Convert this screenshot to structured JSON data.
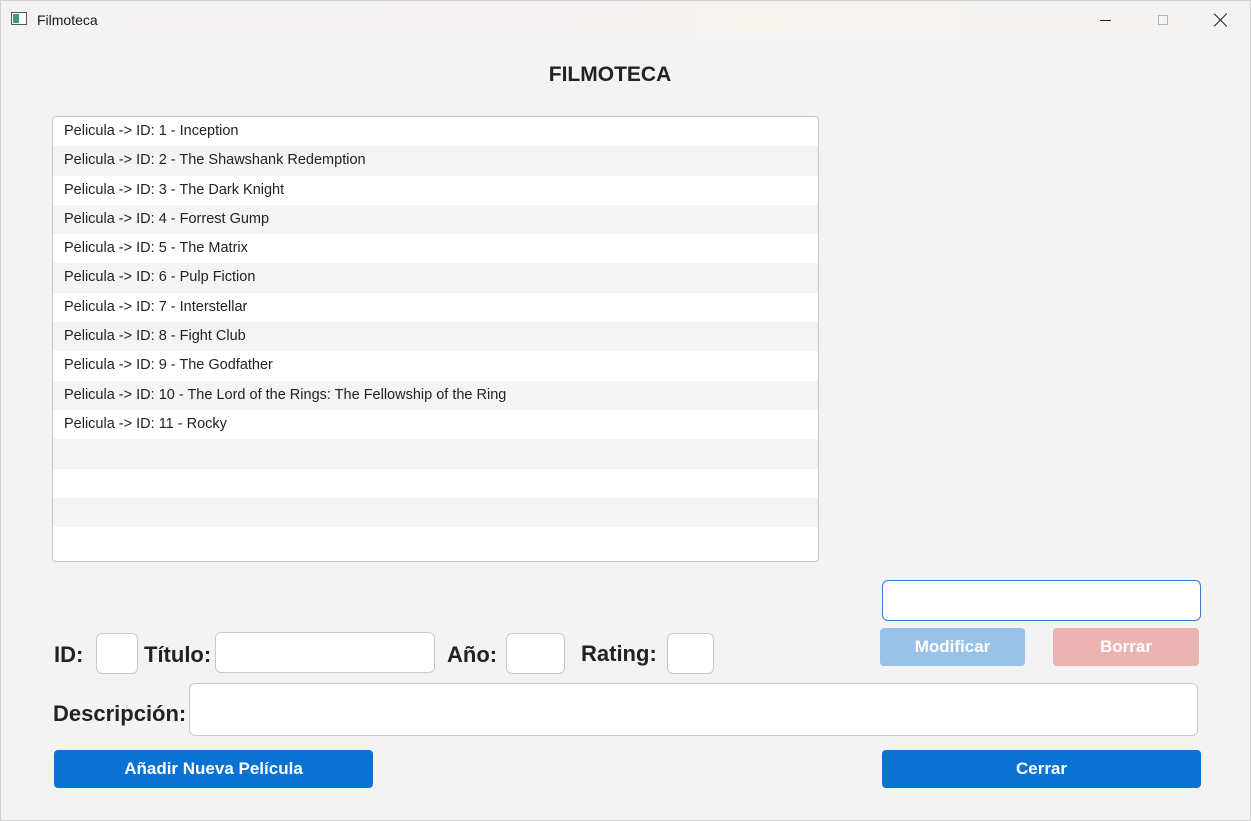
{
  "window": {
    "title": "Filmoteca"
  },
  "heading": "FILMOTECA",
  "movies": [
    "Pelicula -> ID: 1 - Inception",
    "Pelicula -> ID: 2 - The Shawshank Redemption",
    "Pelicula -> ID: 3 - The Dark Knight",
    "Pelicula -> ID: 4 - Forrest Gump",
    "Pelicula -> ID: 5 - The Matrix",
    "Pelicula -> ID: 6 - Pulp Fiction",
    "Pelicula -> ID: 7 - Interstellar",
    "Pelicula -> ID: 8 - Fight Club",
    "Pelicula -> ID: 9 - The Godfather",
    "Pelicula -> ID: 10 - The Lord of the Rings: The Fellowship of the Ring",
    "Pelicula -> ID: 11 - Rocky",
    "",
    "",
    "",
    ""
  ],
  "form": {
    "id_label": "ID:",
    "titulo_label": "Título:",
    "anio_label": "Año:",
    "rating_label": "Rating:",
    "descripcion_label": "Descripción:",
    "id_value": "",
    "titulo_value": "",
    "anio_value": "",
    "rating_value": "",
    "descripcion_value": "",
    "search_value": ""
  },
  "buttons": {
    "modificar": "Modificar",
    "borrar": "Borrar",
    "anadir": "Añadir Nueva Película",
    "cerrar": "Cerrar"
  },
  "colors": {
    "primary": "#0a72d3",
    "modificar_disabled": "#98c2e8",
    "borrar_disabled": "#ebb3b2",
    "focus_border": "#3b7ad0"
  }
}
